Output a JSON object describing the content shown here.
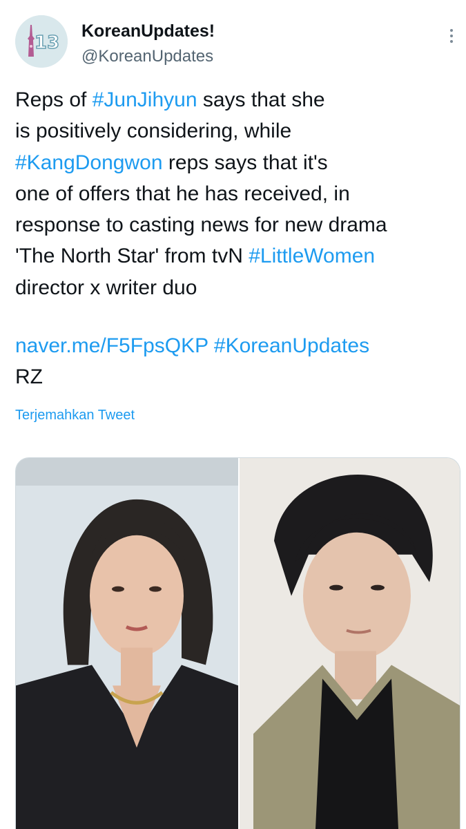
{
  "account": {
    "avatar_badge": "13",
    "display_name": "KoreanUpdates!",
    "handle": "@KoreanUpdates"
  },
  "tweet": {
    "line1_pre": "Reps of ",
    "tag_junjihyun": "#JunJihyun",
    "line1_post": " says that she",
    "line2": "is positively considering, while",
    "tag_kangdongwon": "#KangDongwon",
    "line3_post": " reps says that it's",
    "line4": "one of offers that he has received, in",
    "line5": "response to casting news for new drama",
    "line6_pre": "'The North Star' from tvN ",
    "tag_littlewomen": "#LittleWomen",
    "line7": "director x writer duo",
    "link": "naver.me/F5FpsQKP",
    "tag_koreanupdates": "#KoreanUpdates",
    "signature": "RZ"
  },
  "translate_label": "Terjemahkan Tweet",
  "media": {
    "left_photo": "woman-portrait-photo",
    "right_photo": "man-portrait-photo"
  },
  "colors": {
    "link": "#1d9bf0",
    "text": "#0f1419",
    "secondary": "#536471"
  }
}
